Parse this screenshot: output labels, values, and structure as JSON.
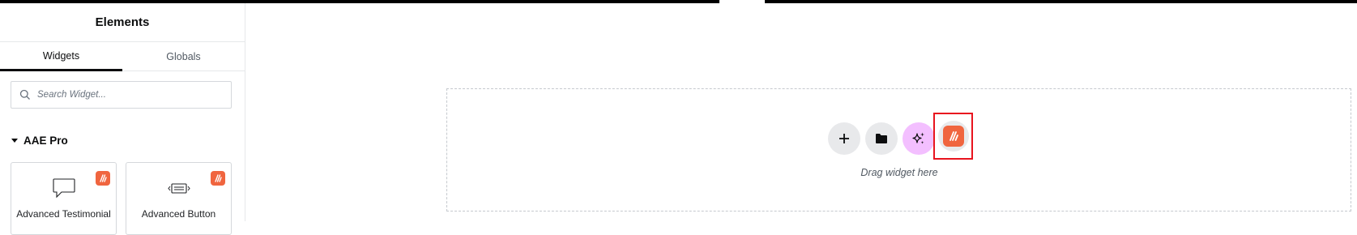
{
  "panel": {
    "title": "Elements",
    "tabs": [
      {
        "label": "Widgets",
        "active": true
      },
      {
        "label": "Globals",
        "active": false
      }
    ],
    "search": {
      "placeholder": "Search Widget...",
      "value": ""
    },
    "category": {
      "label": "AAE Pro",
      "expanded": true
    },
    "widgets": [
      {
        "label": "Advanced Testimonial",
        "icon": "speech-bubble-icon",
        "badge": "aae-pro-badge-icon"
      },
      {
        "label": "Advanced Button",
        "icon": "button-icon",
        "badge": "aae-pro-badge-icon"
      }
    ]
  },
  "canvas": {
    "drop_hint": "Drag widget here",
    "actions": [
      {
        "name": "add-section",
        "icon": "plus-icon"
      },
      {
        "name": "add-template",
        "icon": "folder-icon"
      },
      {
        "name": "ai-generate",
        "icon": "sparkle-icon"
      },
      {
        "name": "aae-templates",
        "icon": "aae-logo-icon",
        "highlighted": true
      }
    ]
  },
  "colors": {
    "accent": "#f0653f",
    "ai": "#f3bfff",
    "highlight": "#e8141e",
    "topbar": "#000000"
  }
}
